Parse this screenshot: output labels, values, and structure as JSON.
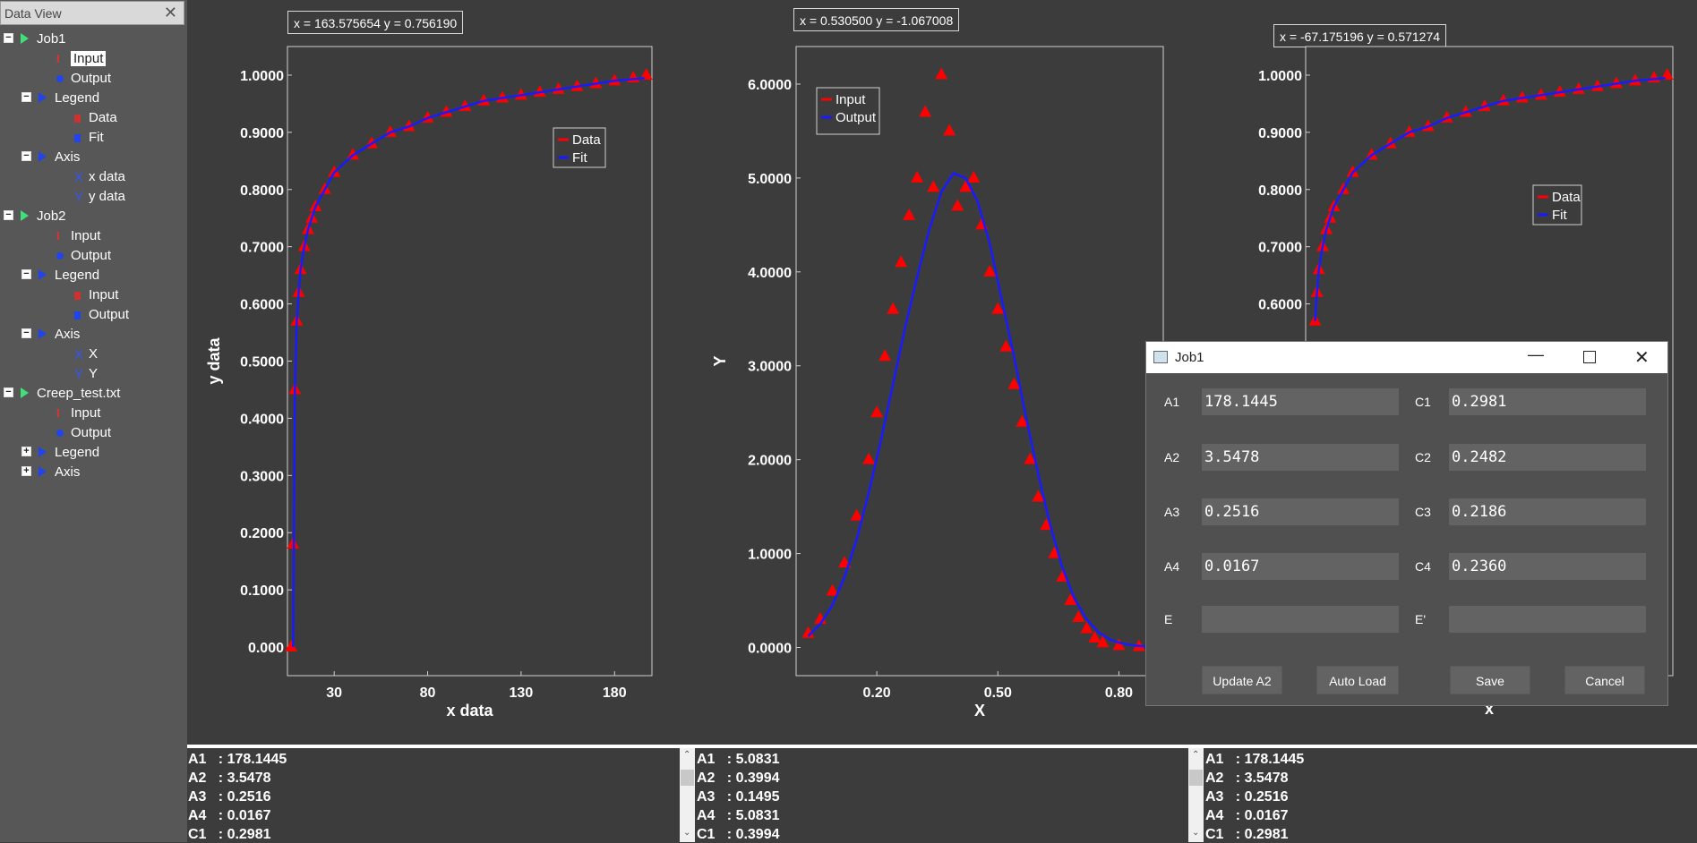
{
  "sidebar": {
    "title": "Data View",
    "tree": [
      {
        "label": "Job1",
        "level": 0,
        "expander": "−",
        "icon": "green-triangle"
      },
      {
        "label": "Input",
        "level": 1,
        "icon": "I-beam",
        "iconText": "I",
        "iconColor": "#e03030",
        "selected": true
      },
      {
        "label": "Output",
        "level": 1,
        "icon": "circle",
        "iconColor": "#2244ee"
      },
      {
        "label": "Legend",
        "level": 1,
        "expander": "−",
        "icon": "blue-triangle"
      },
      {
        "label": "Data",
        "level": 2,
        "icon": "square",
        "iconColor": "#d03030"
      },
      {
        "label": "Fit",
        "level": 2,
        "icon": "square",
        "iconColor": "#2244ee"
      },
      {
        "label": "Axis",
        "level": 1,
        "expander": "−",
        "icon": "blue-triangle"
      },
      {
        "label": "x data",
        "level": 2,
        "icon": "X",
        "iconText": "X",
        "iconColor": "#3355ff"
      },
      {
        "label": "y data",
        "level": 2,
        "icon": "Y",
        "iconText": "Y",
        "iconColor": "#3355ff"
      },
      {
        "label": "Job2",
        "level": 0,
        "expander": "−",
        "icon": "green-triangle"
      },
      {
        "label": "Input",
        "level": 1,
        "icon": "I-beam",
        "iconText": "I",
        "iconColor": "#e03030"
      },
      {
        "label": "Output",
        "level": 1,
        "icon": "circle",
        "iconColor": "#2244ee"
      },
      {
        "label": "Legend",
        "level": 1,
        "expander": "−",
        "icon": "blue-triangle"
      },
      {
        "label": "Input",
        "level": 2,
        "icon": "square",
        "iconColor": "#d03030"
      },
      {
        "label": "Output",
        "level": 2,
        "icon": "square",
        "iconColor": "#2244ee"
      },
      {
        "label": "Axis",
        "level": 1,
        "expander": "−",
        "icon": "blue-triangle"
      },
      {
        "label": "X",
        "level": 2,
        "icon": "X",
        "iconText": "X",
        "iconColor": "#3355ff"
      },
      {
        "label": "Y",
        "level": 2,
        "icon": "Y",
        "iconText": "Y",
        "iconColor": "#3355ff"
      },
      {
        "label": "Creep_test.txt",
        "level": 0,
        "expander": "−",
        "icon": "green-triangle"
      },
      {
        "label": "Input",
        "level": 1,
        "icon": "I-beam",
        "iconText": "I",
        "iconColor": "#e03030"
      },
      {
        "label": "Output",
        "level": 1,
        "icon": "circle",
        "iconColor": "#2244ee"
      },
      {
        "label": "Legend",
        "level": 1,
        "expander": "+",
        "icon": "blue-triangle"
      },
      {
        "label": "Axis",
        "level": 1,
        "expander": "+",
        "icon": "blue-triangle"
      }
    ]
  },
  "plots": [
    {
      "coords": "x = 163.575654 y = 0.756190",
      "legend": [
        "Data",
        "Fit"
      ]
    },
    {
      "coords": "x = 0.530500 y = -1.067008",
      "legend": [
        "Input",
        "Output"
      ]
    },
    {
      "coords": "x = -67.175196 y = 0.571274",
      "legend": [
        "Data",
        "Fit"
      ]
    }
  ],
  "colors": {
    "data": "#ff0000",
    "fit": "#1a1aff",
    "bg": "#3c3c3c"
  },
  "chart_data": [
    {
      "type": "scatter",
      "xlabel": "x data",
      "ylabel": "y data",
      "xticks": [
        "30",
        "80",
        "130",
        "180"
      ],
      "yticks": [
        "0.000",
        "0.1000",
        "0.2000",
        "0.3000",
        "0.4000",
        "0.5000",
        "0.6000",
        "0.7000",
        "0.8000",
        "0.9000",
        "1.0000"
      ],
      "xlim": [
        5,
        200
      ],
      "ylim": [
        -0.05,
        1.05
      ],
      "series": [
        {
          "name": "Data",
          "style": "triangle",
          "color": "#ff0000",
          "x": [
            7,
            8,
            9,
            10,
            11,
            12,
            14,
            16,
            18,
            20,
            25,
            30,
            40,
            50,
            60,
            70,
            80,
            90,
            100,
            110,
            120,
            130,
            140,
            150,
            160,
            170,
            180,
            190,
            197
          ],
          "y": [
            0.0,
            0.18,
            0.45,
            0.57,
            0.62,
            0.66,
            0.7,
            0.73,
            0.75,
            0.77,
            0.8,
            0.83,
            0.86,
            0.88,
            0.9,
            0.91,
            0.925,
            0.935,
            0.945,
            0.955,
            0.96,
            0.965,
            0.97,
            0.975,
            0.98,
            0.985,
            0.99,
            0.995,
            1.0
          ]
        },
        {
          "name": "Fit",
          "style": "line",
          "color": "#1a1aff",
          "x": [
            8,
            9,
            10,
            11,
            12,
            14,
            16,
            18,
            20,
            25,
            30,
            40,
            50,
            60,
            70,
            80,
            90,
            100,
            110,
            120,
            130,
            140,
            150,
            160,
            170,
            180,
            190,
            196
          ],
          "y": [
            0.0,
            0.45,
            0.57,
            0.62,
            0.66,
            0.7,
            0.73,
            0.75,
            0.77,
            0.8,
            0.83,
            0.86,
            0.88,
            0.9,
            0.91,
            0.925,
            0.935,
            0.945,
            0.955,
            0.96,
            0.965,
            0.97,
            0.975,
            0.98,
            0.985,
            0.99,
            0.993,
            0.995
          ]
        }
      ]
    },
    {
      "type": "scatter",
      "xlabel": "X",
      "ylabel": "Y",
      "xticks": [
        "0.20",
        "0.50",
        "0.80"
      ],
      "yticks": [
        "0.0000",
        "1.0000",
        "2.0000",
        "3.0000",
        "4.0000",
        "5.0000",
        "6.0000"
      ],
      "xlim": [
        0.0,
        0.91
      ],
      "ylim": [
        -0.3,
        6.4
      ],
      "series": [
        {
          "name": "Input",
          "style": "triangle",
          "color": "#ff0000",
          "x": [
            0.03,
            0.06,
            0.09,
            0.12,
            0.15,
            0.18,
            0.2,
            0.22,
            0.24,
            0.26,
            0.28,
            0.3,
            0.32,
            0.34,
            0.36,
            0.38,
            0.4,
            0.42,
            0.44,
            0.46,
            0.48,
            0.5,
            0.52,
            0.54,
            0.56,
            0.58,
            0.6,
            0.62,
            0.64,
            0.66,
            0.68,
            0.7,
            0.72,
            0.74,
            0.76,
            0.8,
            0.85
          ],
          "y": [
            0.15,
            0.3,
            0.6,
            0.9,
            1.4,
            2.0,
            2.5,
            3.1,
            3.6,
            4.1,
            4.6,
            5.0,
            5.7,
            4.9,
            6.1,
            5.5,
            4.7,
            4.9,
            5.0,
            4.5,
            4.0,
            3.6,
            3.2,
            2.8,
            2.4,
            2.0,
            1.6,
            1.3,
            1.0,
            0.75,
            0.5,
            0.32,
            0.2,
            0.1,
            0.05,
            0.02,
            0.01
          ]
        },
        {
          "name": "Output",
          "style": "line",
          "color": "#1a1aff",
          "x": [
            0.03,
            0.06,
            0.09,
            0.12,
            0.15,
            0.18,
            0.21,
            0.24,
            0.27,
            0.3,
            0.33,
            0.36,
            0.39,
            0.42,
            0.45,
            0.48,
            0.51,
            0.54,
            0.57,
            0.6,
            0.63,
            0.66,
            0.69,
            0.72,
            0.75,
            0.78,
            0.81,
            0.84,
            0.87,
            0.9
          ],
          "y": [
            0.12,
            0.25,
            0.45,
            0.75,
            1.15,
            1.65,
            2.2,
            2.8,
            3.4,
            3.95,
            4.45,
            4.85,
            5.05,
            5.0,
            4.75,
            4.3,
            3.7,
            3.1,
            2.45,
            1.85,
            1.3,
            0.85,
            0.52,
            0.3,
            0.16,
            0.08,
            0.04,
            0.02,
            0.01,
            0.0
          ]
        }
      ]
    },
    {
      "type": "scatter",
      "xlabel": "x",
      "ylabel": "",
      "xticks": [],
      "yticks": [
        "0.6000",
        "0.7000",
        "0.8000",
        "0.9000",
        "1.0000"
      ],
      "xlim": [
        5,
        200
      ],
      "ylim": [
        -0.05,
        1.05
      ],
      "series": [
        {
          "name": "Data",
          "style": "triangle",
          "color": "#ff0000",
          "x": [
            10,
            11,
            12,
            14,
            16,
            18,
            20,
            25,
            30,
            40,
            50,
            60,
            70,
            80,
            90,
            100,
            110,
            120,
            130,
            140,
            150,
            160,
            170,
            180,
            190,
            197
          ],
          "y": [
            0.57,
            0.62,
            0.66,
            0.7,
            0.73,
            0.75,
            0.77,
            0.8,
            0.83,
            0.86,
            0.88,
            0.9,
            0.91,
            0.925,
            0.935,
            0.945,
            0.955,
            0.96,
            0.965,
            0.97,
            0.975,
            0.98,
            0.985,
            0.99,
            0.995,
            1.0
          ]
        },
        {
          "name": "Fit",
          "style": "line",
          "color": "#1a1aff",
          "x": [
            10,
            11,
            12,
            14,
            16,
            18,
            20,
            25,
            30,
            40,
            50,
            60,
            70,
            80,
            90,
            100,
            110,
            120,
            130,
            140,
            150,
            160,
            170,
            180,
            190,
            196
          ],
          "y": [
            0.57,
            0.62,
            0.66,
            0.7,
            0.73,
            0.75,
            0.77,
            0.8,
            0.83,
            0.86,
            0.88,
            0.9,
            0.91,
            0.925,
            0.935,
            0.945,
            0.955,
            0.96,
            0.965,
            0.97,
            0.975,
            0.98,
            0.985,
            0.99,
            0.993,
            0.995
          ]
        }
      ]
    }
  ],
  "params": [
    [
      "A1   : 178.1445",
      "A2   : 3.5478",
      "A3   : 0.2516",
      "A4   : 0.0167",
      "C1   : 0.2981"
    ],
    [
      "A1   : 5.0831",
      "A2   : 0.3994",
      "A3   : 0.1495",
      "A4   : 5.0831",
      "C1   : 0.3994"
    ],
    [
      "A1   : 178.1445",
      "A2   : 3.5478",
      "A3   : 0.2516",
      "A4   : 0.0167",
      "C1   : 0.2981"
    ]
  ],
  "dialog": {
    "title": "Job1",
    "fields": [
      {
        "label": "A1",
        "value": "178.1445",
        "label2": "C1",
        "value2": "0.2981"
      },
      {
        "label": "A2",
        "value": "3.5478",
        "label2": "C2",
        "value2": "0.2482"
      },
      {
        "label": "A3",
        "value": "0.2516",
        "label2": "C3",
        "value2": "0.2186"
      },
      {
        "label": "A4",
        "value": "0.0167",
        "label2": "C4",
        "value2": "0.2360"
      },
      {
        "label": "E",
        "value": "",
        "label2": "E'",
        "value2": ""
      }
    ],
    "buttons": {
      "update": "Update A2",
      "autoload": "Auto Load",
      "save": "Save",
      "cancel": "Cancel"
    }
  }
}
